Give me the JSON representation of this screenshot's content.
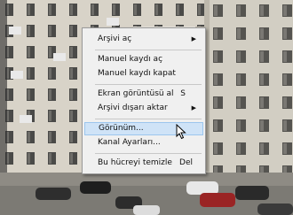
{
  "context_menu": {
    "items": [
      {
        "id": "archive_open",
        "label": "Arşivi aç",
        "shortcut": "",
        "submenu": true,
        "highlighted": false
      },
      {
        "id": "manual_record_open",
        "label": "Manuel kaydı aç",
        "shortcut": "",
        "submenu": false,
        "highlighted": false
      },
      {
        "id": "manual_record_close",
        "label": "Manuel kaydı kapat",
        "shortcut": "",
        "submenu": false,
        "highlighted": false
      },
      {
        "id": "screenshot",
        "label": "Ekran görüntüsü al",
        "shortcut": "S",
        "submenu": false,
        "highlighted": false
      },
      {
        "id": "export_archive",
        "label": "Arşivi dışarı aktar",
        "shortcut": "",
        "submenu": true,
        "highlighted": false
      },
      {
        "id": "view",
        "label": "Görünüm...",
        "shortcut": "",
        "submenu": false,
        "highlighted": true
      },
      {
        "id": "channel_settings",
        "label": "Kanal Ayarları...",
        "shortcut": "",
        "submenu": false,
        "highlighted": false
      },
      {
        "id": "clear_cell",
        "label": "Bu hücreyi temizle",
        "shortcut": "Del",
        "submenu": false,
        "highlighted": false
      }
    ]
  },
  "icons": {
    "submenu_arrow": "triangle-right-icon",
    "cursor": "mouse-pointer-icon"
  },
  "colors": {
    "menu_bg": "#f0f0f0",
    "highlight": "#cfe3f7",
    "highlight_border": "#9cc6ee"
  }
}
